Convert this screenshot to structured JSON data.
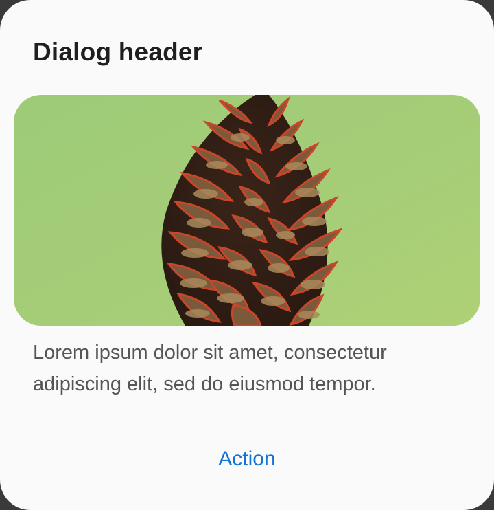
{
  "dialog": {
    "header": "Dialog header",
    "image": {
      "subject": "pinecone",
      "background_color": "#a8cf7a"
    },
    "body": "Lorem ipsum dolor sit amet, consectetur adipiscing elit, sed do eiusmod tempor.",
    "action_label": "Action",
    "accent_color": "#1273d6"
  }
}
